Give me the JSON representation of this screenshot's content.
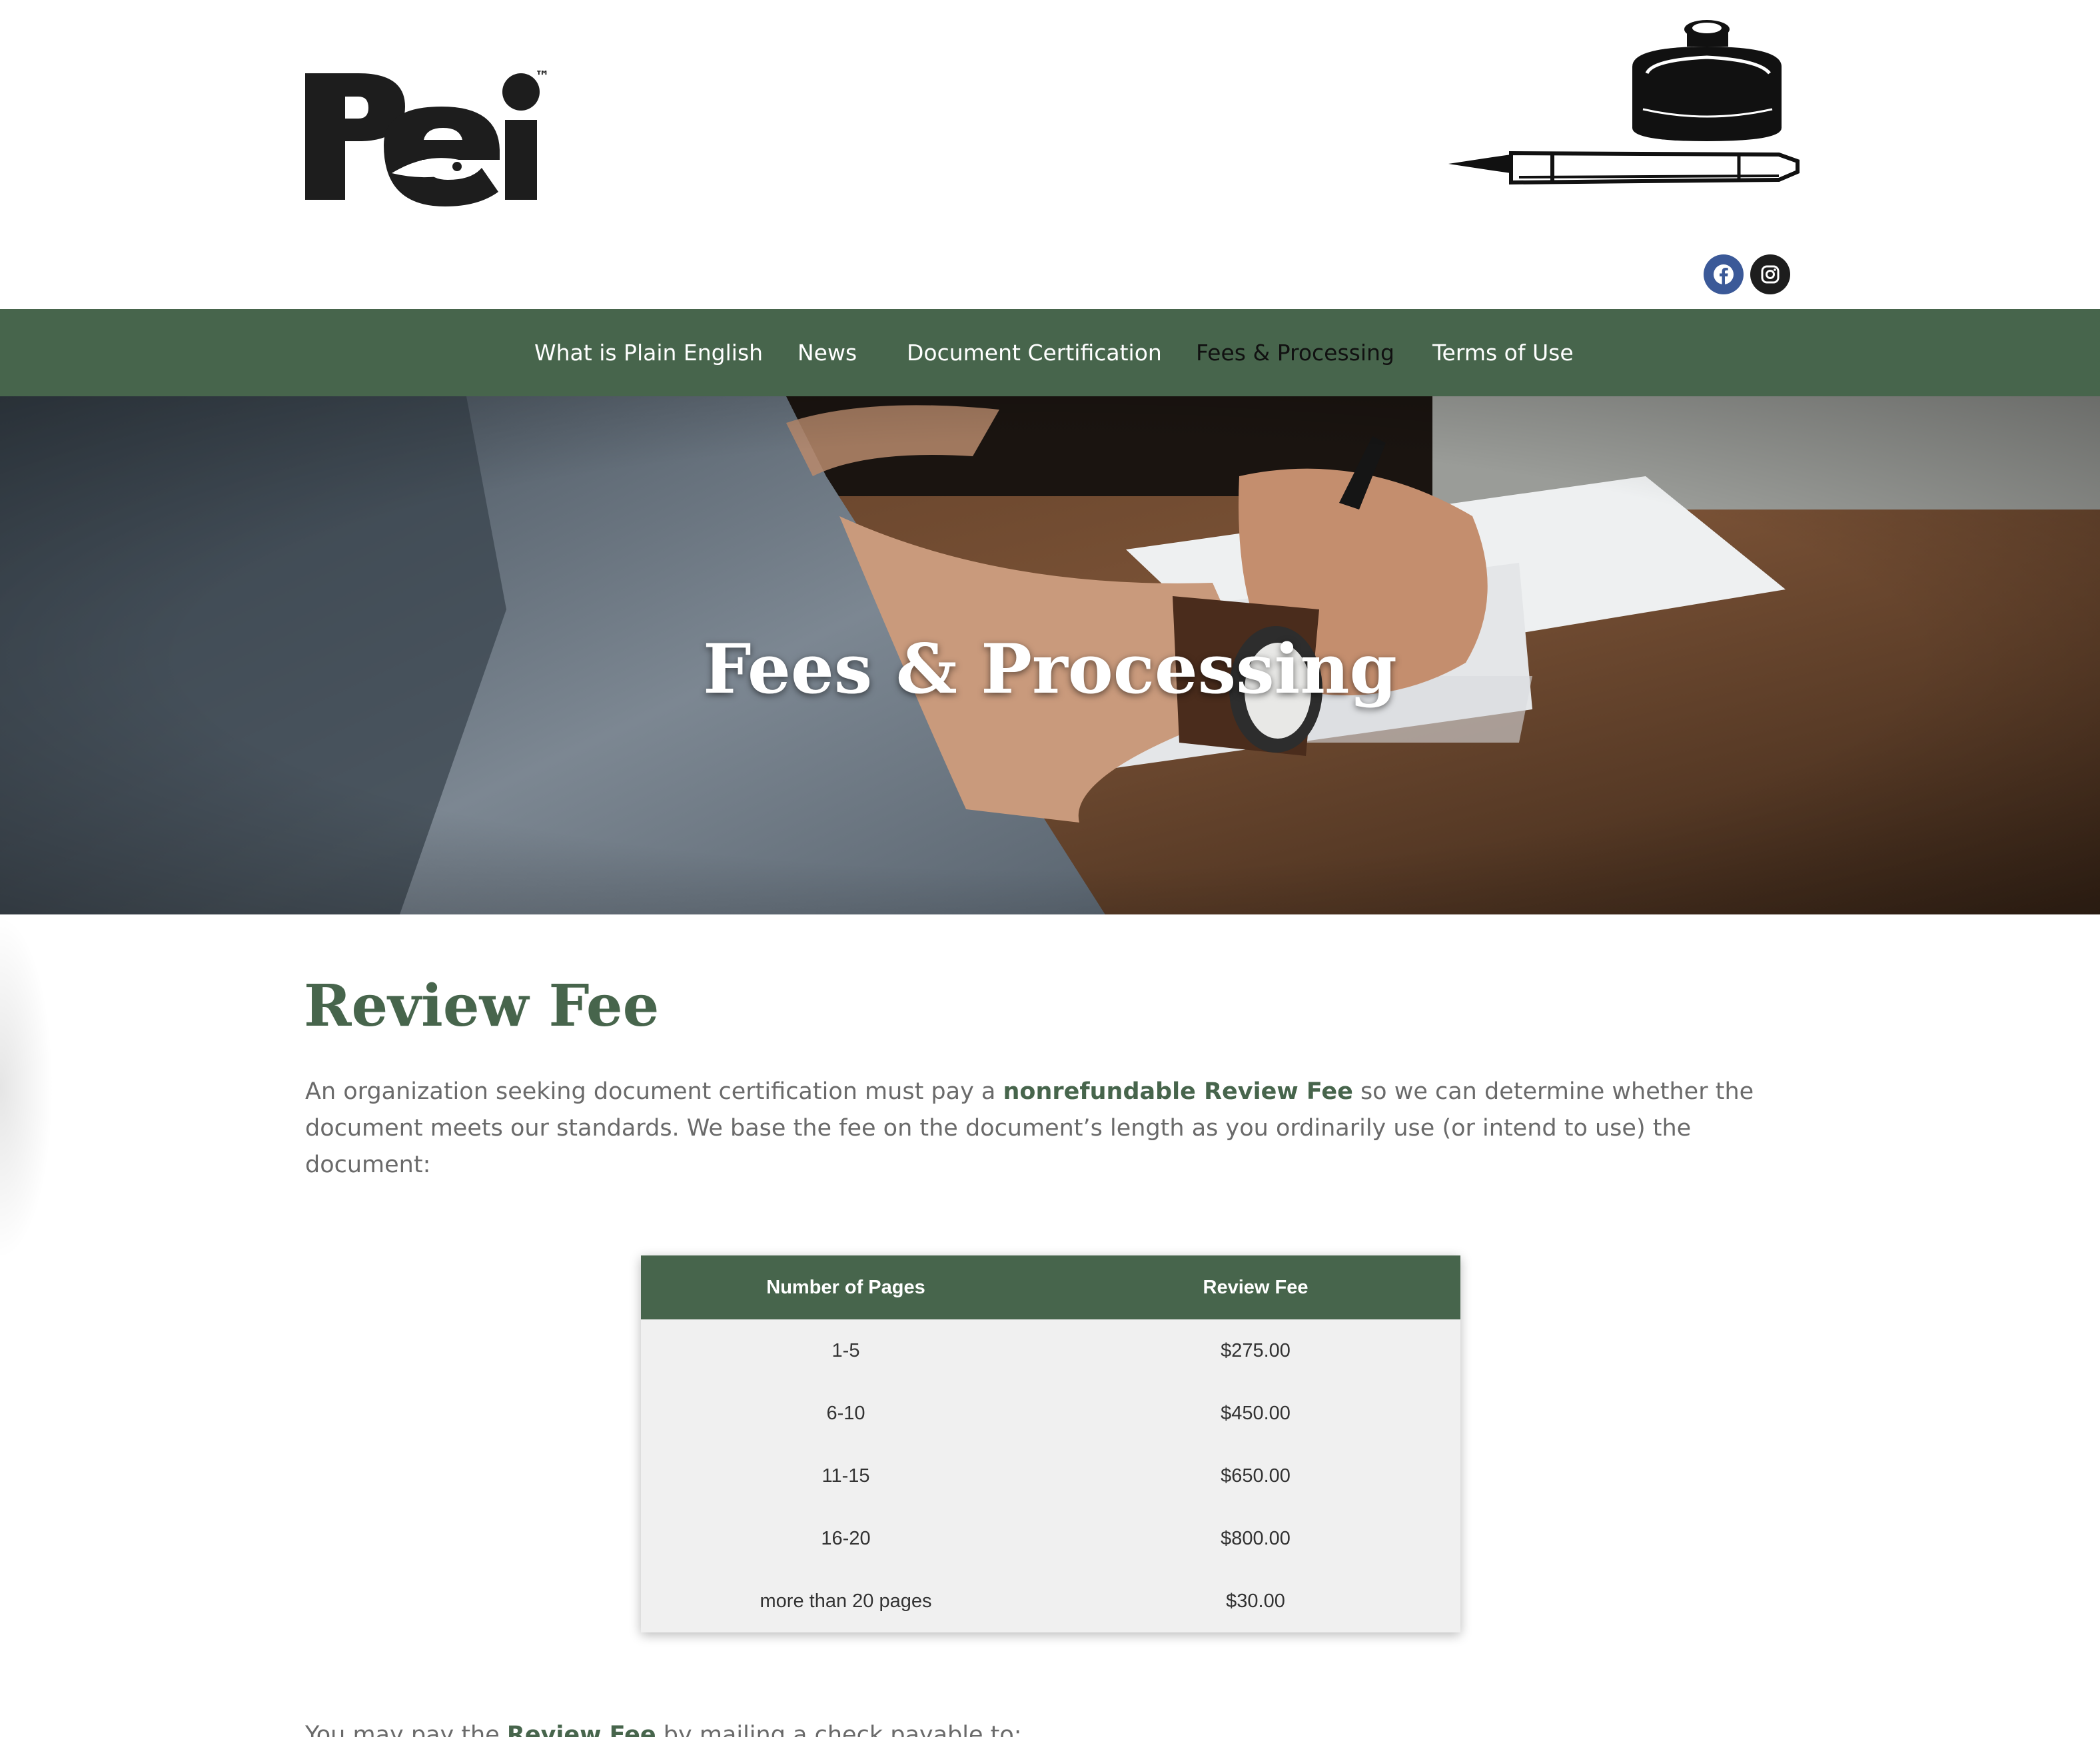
{
  "header": {
    "logo": {
      "text": "Pei",
      "trademark": "™"
    },
    "illustration": "ink-bottle-and-fountain-pen"
  },
  "social": [
    {
      "name": "facebook",
      "icon": "facebook-icon",
      "color": "#3b5998"
    },
    {
      "name": "instagram",
      "icon": "instagram-icon",
      "color": "#1d1d1d"
    }
  ],
  "nav": {
    "items": [
      {
        "label": "What is Plain English"
      },
      {
        "label": "News"
      },
      {
        "label": "Document Certification"
      },
      {
        "label": "Fees & Processing",
        "active": true
      },
      {
        "label": "Terms of Use"
      }
    ]
  },
  "hero": {
    "title": "Fees & Processing"
  },
  "review_fee": {
    "title": "Review Fee",
    "intro_before": "An organization seeking document certification must pay a ",
    "intro_bold": "nonrefundable Review Fee",
    "intro_after": " so we can determine whether the document meets our standards. We base the fee on the document’s length as you ordinarily use (or intend to use) the document:",
    "table": {
      "headers": [
        "Number of Pages",
        "Review Fee"
      ],
      "rows": [
        [
          "1-5",
          "$275.00"
        ],
        [
          "6-10",
          "$450.00"
        ],
        [
          "11-15",
          "$650.00"
        ],
        [
          "16-20",
          "$800.00"
        ],
        [
          "more than 20 pages",
          "$30.00"
        ]
      ]
    },
    "outro_before": "You may pay the ",
    "outro_bold": "Review Fee",
    "outro_after": " by mailing a check payable to:"
  },
  "colors": {
    "brand_green": "#47654c",
    "text_gray": "#6a6a6a",
    "table_row_bg": "#f0f0f0"
  }
}
